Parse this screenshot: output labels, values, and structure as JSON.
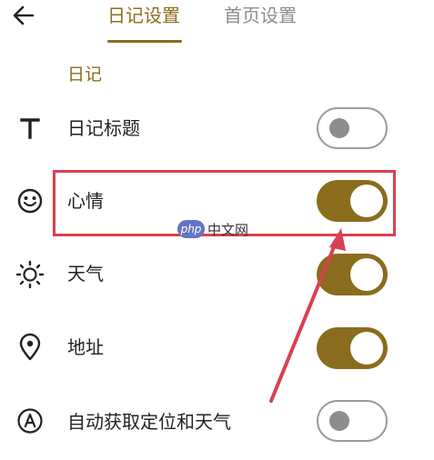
{
  "header": {
    "back_icon": "back-arrow-icon",
    "tabs": [
      {
        "label": "日记设置",
        "active": true
      },
      {
        "label": "首页设置",
        "active": false
      }
    ]
  },
  "section": {
    "title": "日记"
  },
  "settings": [
    {
      "label": "日记标题",
      "icon": "text-t-icon",
      "enabled": false
    },
    {
      "label": "心情",
      "icon": "smiley-face-icon",
      "enabled": true
    },
    {
      "label": "天气",
      "icon": "sun-icon",
      "enabled": true
    },
    {
      "label": "地址",
      "icon": "location-pin-icon",
      "enabled": true
    },
    {
      "label": "自动获取定位和天气",
      "icon": "circle-a-icon",
      "enabled": false
    }
  ],
  "watermark": {
    "badge": "php",
    "text": "中文网"
  },
  "colors": {
    "accent": "#8a6d1d",
    "toggle_off_knob": "#8d8d8d",
    "annotation": "#d8414f",
    "inactive_tab": "#8c8c8c"
  }
}
